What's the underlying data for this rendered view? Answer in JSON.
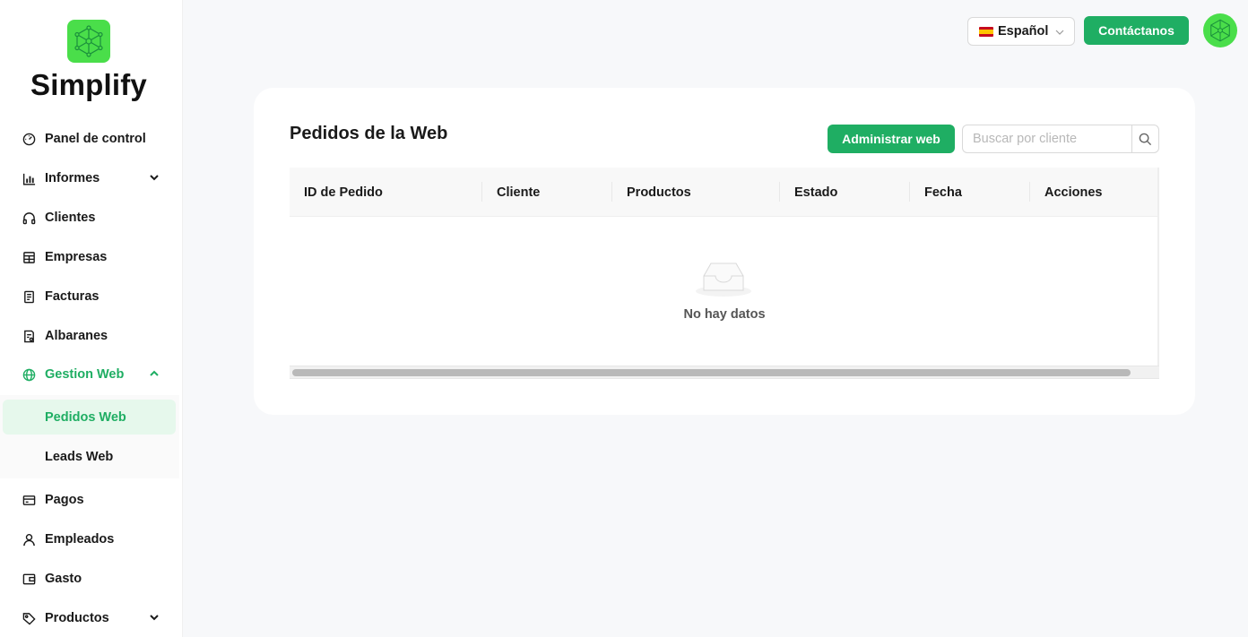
{
  "brand": {
    "name": "Simplify"
  },
  "colors": {
    "accent": "#1fae63",
    "logo_green": "#4ade4a",
    "selected_bg": "#e6f8ec"
  },
  "sidebar": {
    "items": [
      {
        "label": "Panel de control",
        "icon": "dashboard-icon"
      },
      {
        "label": "Informes",
        "icon": "bar-chart-icon",
        "expandable": true
      },
      {
        "label": "Clientes",
        "icon": "headphones-icon"
      },
      {
        "label": "Empresas",
        "icon": "store-icon"
      },
      {
        "label": "Facturas",
        "icon": "invoice-icon"
      },
      {
        "label": "Albaranes",
        "icon": "delivery-note-icon"
      },
      {
        "label": "Gestion Web",
        "icon": "globe-icon",
        "expanded": true,
        "children": [
          {
            "label": "Pedidos Web",
            "selected": true
          },
          {
            "label": "Leads Web"
          }
        ]
      },
      {
        "label": "Pagos",
        "icon": "credit-card-icon"
      },
      {
        "label": "Empleados",
        "icon": "user-icon"
      },
      {
        "label": "Gasto",
        "icon": "wallet-icon"
      },
      {
        "label": "Productos",
        "icon": "tag-icon",
        "expandable": true
      }
    ]
  },
  "header": {
    "language": "Español",
    "contact_label": "Contáctanos"
  },
  "main": {
    "title": "Pedidos de la Web",
    "admin_button": "Administrar web",
    "search_placeholder": "Buscar por cliente",
    "table": {
      "columns": [
        "ID de Pedido",
        "Cliente",
        "Productos",
        "Estado",
        "Fecha",
        "Acciones"
      ],
      "rows": [],
      "empty_text": "No hay datos"
    }
  }
}
